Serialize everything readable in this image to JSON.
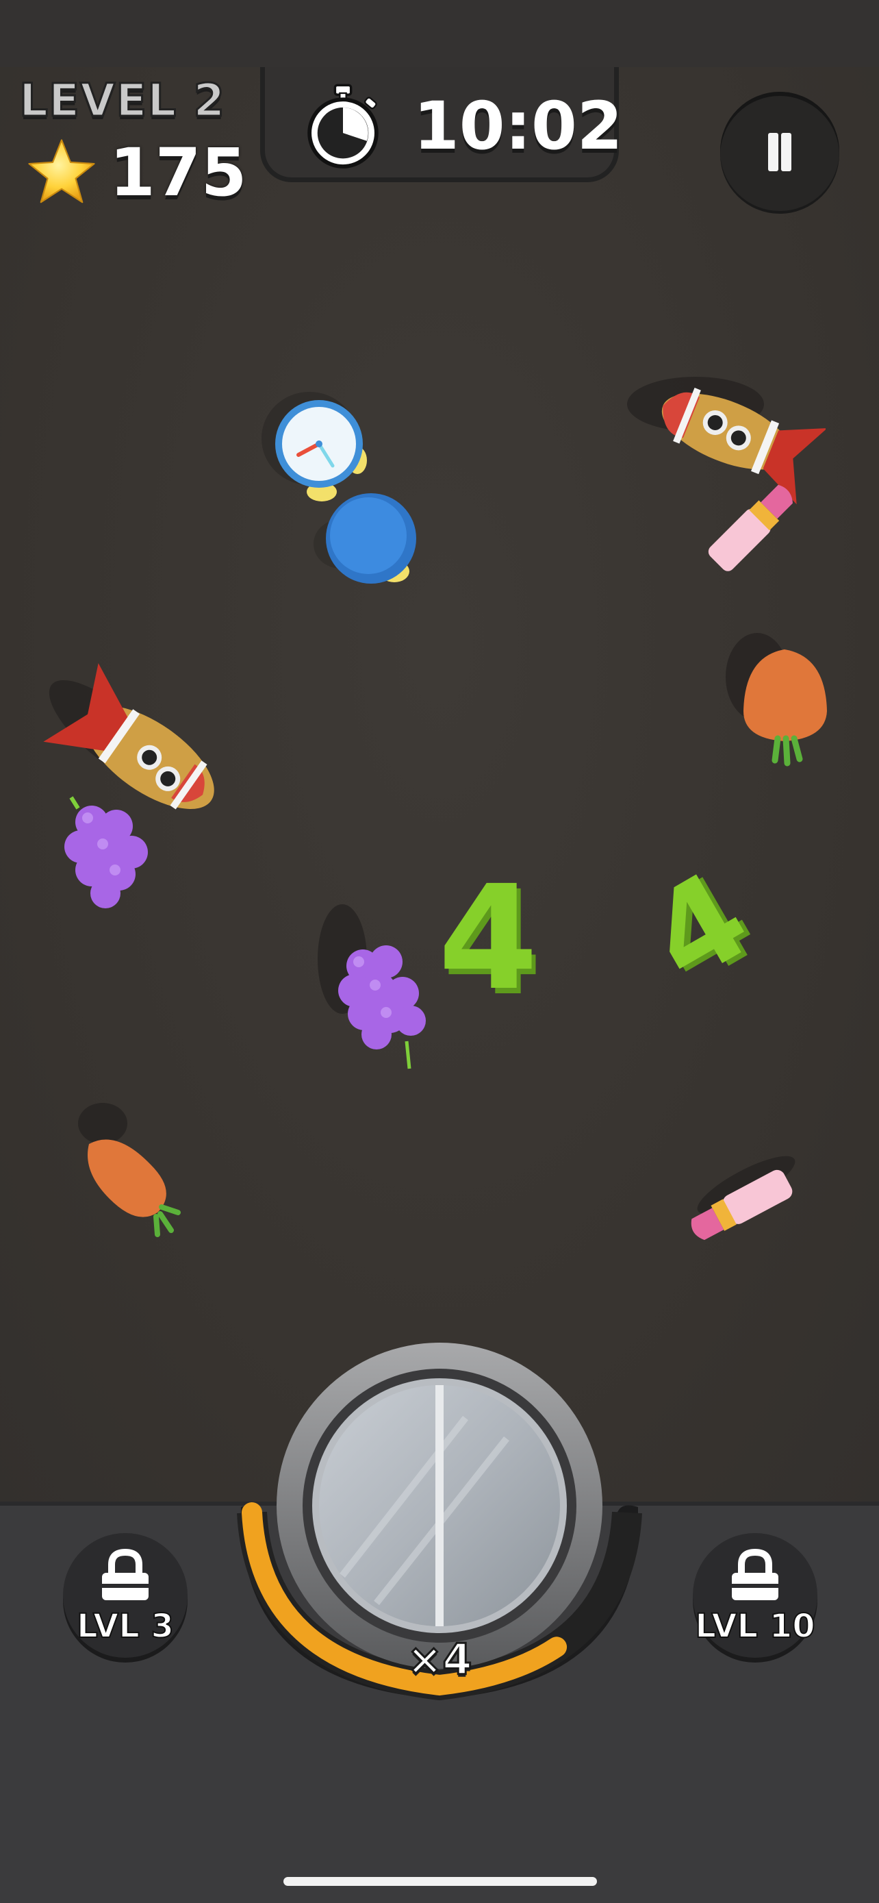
{
  "hud": {
    "level_label": "LEVEL 2",
    "score": "175",
    "timer": "10:02"
  },
  "powerups": {
    "left_label": "LVL 3",
    "right_label": "LVL 10",
    "multiplier": "×4",
    "magnet_progress": 0.72
  },
  "colors": {
    "background": "#3a3734",
    "progress": "#f0a21f",
    "number_green": "#86d02a"
  },
  "items": [
    {
      "name": "alarm-clock",
      "icon": "alarm-clock-icon"
    },
    {
      "name": "blue-button",
      "icon": "blue-cylinder-icon"
    },
    {
      "name": "rocket",
      "icon": "rocket-icon"
    },
    {
      "name": "lipstick",
      "icon": "lipstick-icon"
    },
    {
      "name": "carrot",
      "icon": "carrot-icon"
    },
    {
      "name": "rocket",
      "icon": "rocket-icon"
    },
    {
      "name": "grapes",
      "icon": "grapes-icon"
    },
    {
      "name": "number",
      "text": "4"
    },
    {
      "name": "number",
      "text": "4"
    },
    {
      "name": "grapes",
      "icon": "grapes-icon"
    },
    {
      "name": "carrot",
      "icon": "carrot-icon"
    },
    {
      "name": "lipstick",
      "icon": "lipstick-icon"
    }
  ]
}
